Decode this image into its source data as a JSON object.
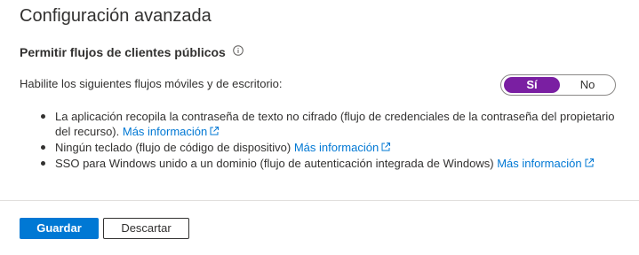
{
  "page": {
    "title": "Configuración avanzada"
  },
  "section": {
    "title": "Permitir flujos de clientes públicos"
  },
  "prompt": {
    "label": "Habilite los siguientes flujos móviles y de escritorio:"
  },
  "toggle": {
    "yes_label": "Sí",
    "no_label": "No",
    "selected": "Sí"
  },
  "bullets": [
    {
      "text": "La aplicación recopila la contraseña de texto no cifrado (flujo de credenciales de la contraseña del propietario del recurso).",
      "link": "Más información"
    },
    {
      "text": "Ningún teclado (flujo de código de dispositivo)",
      "link": "Más información"
    },
    {
      "text": "SSO para Windows unido a un dominio (flujo de autenticación integrada de Windows)",
      "link": "Más información"
    }
  ],
  "footer": {
    "save_label": "Guardar",
    "discard_label": "Descartar"
  },
  "colors": {
    "accent": "#0078d4",
    "toggle_on": "#8a2da8"
  }
}
